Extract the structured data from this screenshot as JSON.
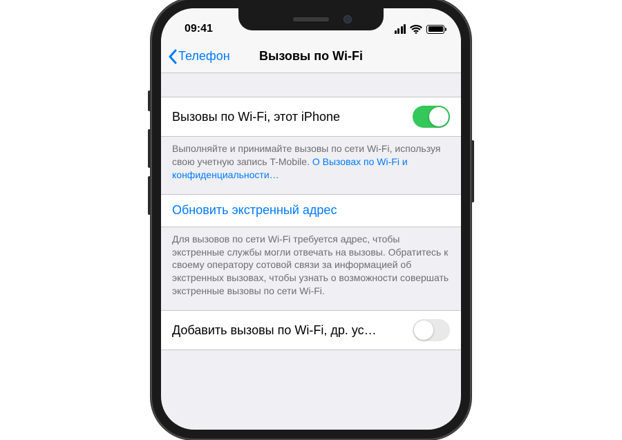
{
  "status": {
    "time": "09:41"
  },
  "nav": {
    "back": "Телефон",
    "title": "Вызовы по Wi-Fi"
  },
  "row1": {
    "label": "Вызовы по Wi-Fi, этот iPhone",
    "toggle": true
  },
  "footer1": {
    "text": "Выполняйте и принимайте вызовы по сети Wi-Fi, используя свою учетную запись T-Mobile. ",
    "link": "О Вызовах по Wi-Fi и конфиденциальности…"
  },
  "row2": {
    "label": "Обновить экстренный адрес"
  },
  "footer2": {
    "text": "Для вызовов по сети Wi-Fi требуется адрес, чтобы экстренные службы могли отвечать на вызовы. Обратитесь к своему оператору сотовой связи за информацией об экстренных вызовах, чтобы узнать о возможности совершать экстренные вызовы по сети Wi-Fi."
  },
  "row3": {
    "label": "Добавить вызовы по Wi-Fi, др. ус…",
    "toggle": false
  }
}
